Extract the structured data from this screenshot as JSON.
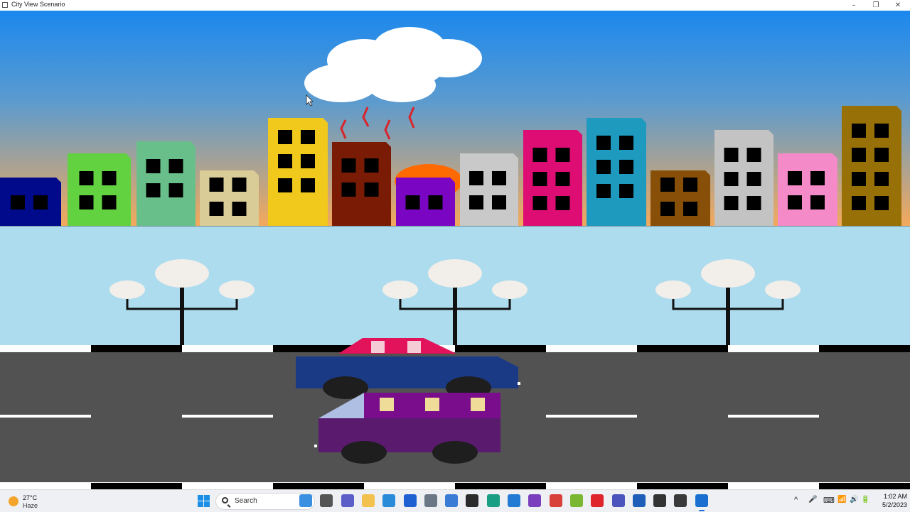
{
  "window": {
    "title": "City View Scenario",
    "controls": {
      "minimize": "–",
      "maximize": "❐",
      "close": "✕"
    }
  },
  "scene": {
    "colors": {
      "sky_top": "#1b88ee",
      "sky_mid": "#5b9bcf",
      "sky_horizon": "#f3a95c",
      "sun": "#ff6a00",
      "cloud": "#ffffff",
      "smoke": "#d9242b",
      "sidewalk": "#addcee",
      "curb_white": "#ffffff",
      "curb_black": "#000000",
      "road": "#525252",
      "lane_marking": "#ffffff",
      "lamp_pole": "#111111",
      "lamp_globe": "#f2eeea",
      "window": "#000000"
    },
    "buildings": [
      {
        "name": "building-navy",
        "color": "#000a8a"
      },
      {
        "name": "building-lime",
        "color": "#62d240"
      },
      {
        "name": "building-seafoam",
        "color": "#69bf8a"
      },
      {
        "name": "building-tan",
        "color": "#d9cc97"
      },
      {
        "name": "building-yellow",
        "color": "#f0c91c"
      },
      {
        "name": "building-maroon",
        "color": "#7a1c05"
      },
      {
        "name": "building-purple",
        "color": "#7a06c3"
      },
      {
        "name": "building-lightgray",
        "color": "#c9c9c9"
      },
      {
        "name": "building-magenta",
        "color": "#dd0d73"
      },
      {
        "name": "building-teal",
        "color": "#1f9abf"
      },
      {
        "name": "building-brown",
        "color": "#874f07"
      },
      {
        "name": "building-silver",
        "color": "#c3c3c3"
      },
      {
        "name": "building-pink",
        "color": "#f48ac8"
      },
      {
        "name": "building-olive",
        "color": "#977007"
      }
    ],
    "street_lamps": 3,
    "vehicles": [
      {
        "name": "car",
        "cabin_color": "#e2125b",
        "window_color": "#f5cbd6",
        "body_color": "#1b3a86",
        "wheel_color": "#1e1e1e"
      },
      {
        "name": "bus",
        "body_color": "#7a0d8c",
        "lower_color": "#5a1a6e",
        "windshield_color": "#aebfe3",
        "window_color": "#f0dc99",
        "wheel_color": "#1e1e1e"
      }
    ]
  },
  "taskbar": {
    "weather": {
      "temperature": "27°C",
      "condition": "Haze"
    },
    "search_label": "Search",
    "apps": [
      {
        "name": "widgets-icon",
        "color": "#3a8fe0"
      },
      {
        "name": "task-view-icon",
        "color": "#555555"
      },
      {
        "name": "teams-chat-icon",
        "color": "#5b5fc7"
      },
      {
        "name": "file-explorer-icon",
        "color": "#f2c14e"
      },
      {
        "name": "photos-icon",
        "color": "#2a8bd8"
      },
      {
        "name": "vs-code-alt-icon",
        "color": "#1e5fd1"
      },
      {
        "name": "settings-icon",
        "color": "#6b7785"
      },
      {
        "name": "notepad-icon",
        "color": "#3a7bd5"
      },
      {
        "name": "terminal-icon",
        "color": "#2b2b2b"
      },
      {
        "name": "edge-icon",
        "color": "#1a9e83"
      },
      {
        "name": "vscode-icon",
        "color": "#237bd3"
      },
      {
        "name": "visual-studio-icon",
        "color": "#7b3fbe"
      },
      {
        "name": "app-grid-icon",
        "color": "#d8413a"
      },
      {
        "name": "pycharm-icon",
        "color": "#7ab733"
      },
      {
        "name": "opera-icon",
        "color": "#e0242b"
      },
      {
        "name": "teams-icon",
        "color": "#4b53bc"
      },
      {
        "name": "word-icon",
        "color": "#1f5eb8"
      },
      {
        "name": "obs-icon",
        "color": "#333333"
      },
      {
        "name": "console-icon",
        "color": "#3a3a3a"
      },
      {
        "name": "running-app-icon",
        "color": "#1b6fd1"
      }
    ],
    "tray": {
      "chevron": "^",
      "mic": "🎤",
      "keyboard": "⌨",
      "wifi": "📶",
      "volume": "🔊",
      "battery": "🔋"
    },
    "clock": {
      "time": "1:02 AM",
      "date": "5/2/2023"
    }
  }
}
